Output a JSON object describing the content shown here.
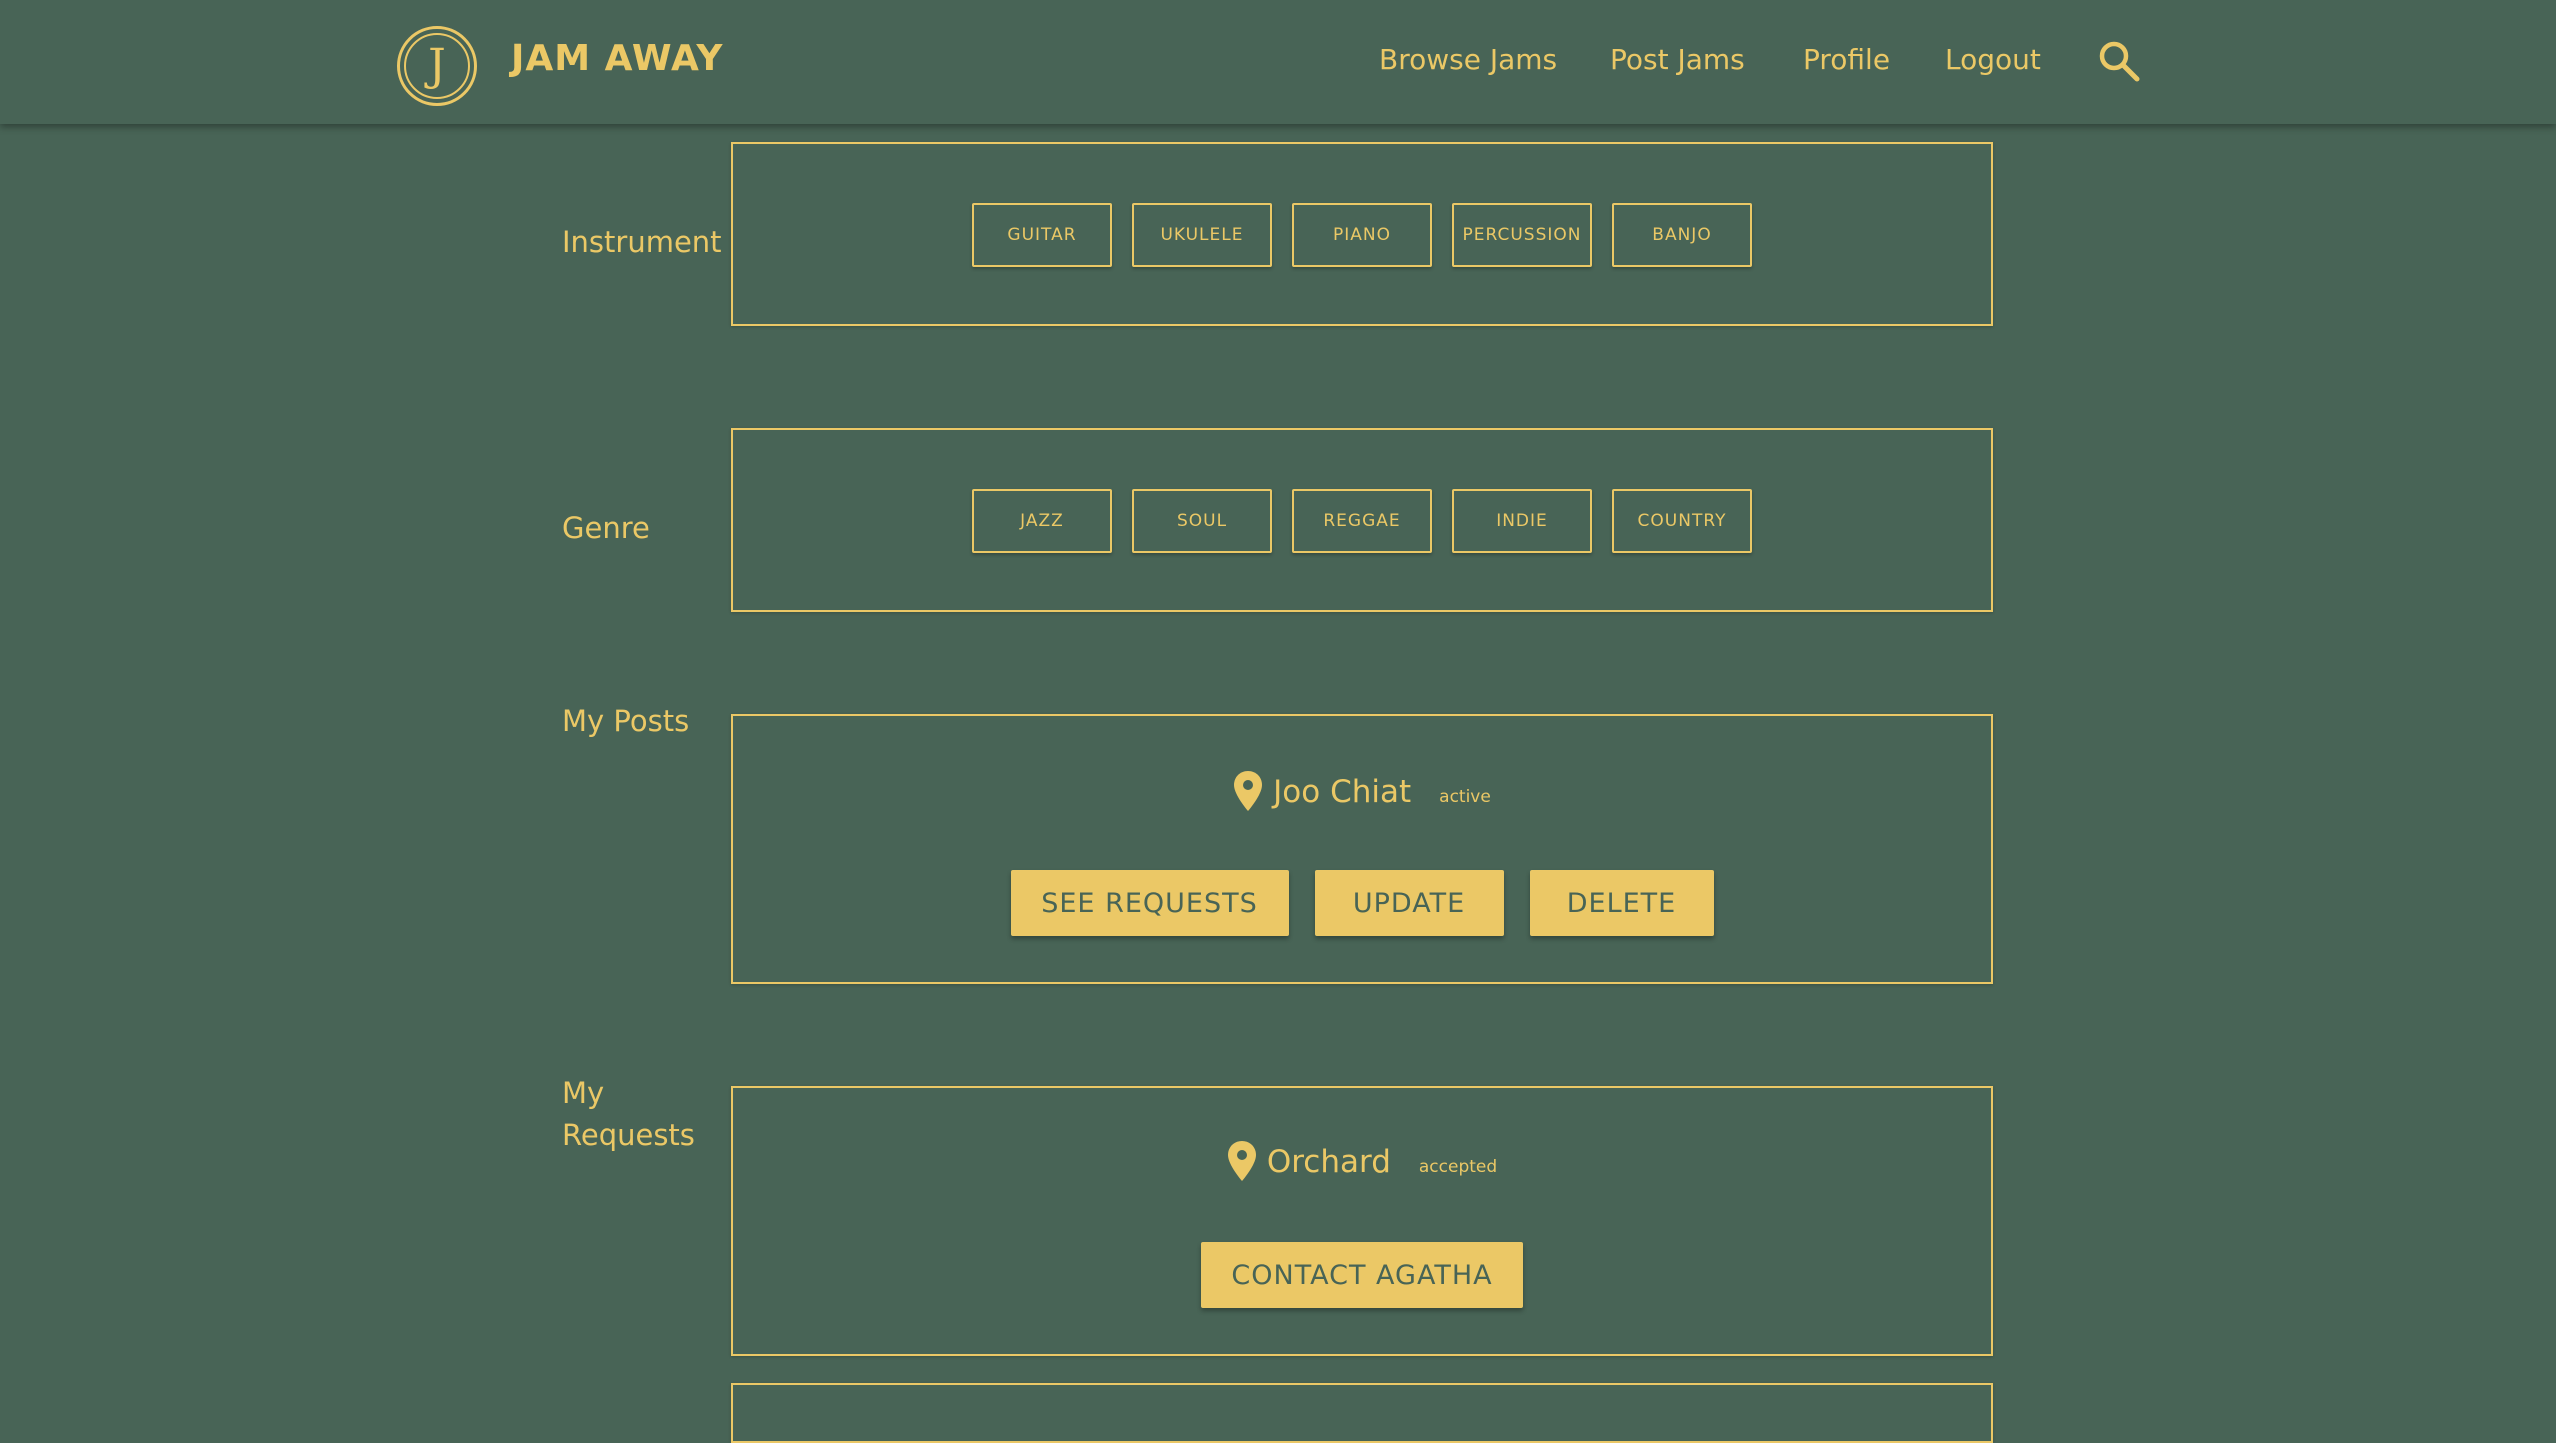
{
  "nav": {
    "logo_letter": "J",
    "brand": "JAM AWAY",
    "links": [
      "Browse Jams",
      "Post Jams",
      "Profile",
      "Logout"
    ]
  },
  "instrument": {
    "label": "Instrument",
    "options": [
      "GUITAR",
      "UKULELE",
      "PIANO",
      "PERCUSSION",
      "BANJO"
    ]
  },
  "genre": {
    "label": "Genre",
    "options": [
      "JAZZ",
      "SOUL",
      "REGGAE",
      "INDIE",
      "COUNTRY"
    ]
  },
  "my_posts": {
    "label": "My Posts",
    "location": "Joo Chiat",
    "status": "active",
    "buttons": [
      "SEE REQUESTS",
      "UPDATE",
      "DELETE"
    ]
  },
  "my_requests": {
    "label_line1": "My",
    "label_line2": "Requests",
    "location": "Orchard",
    "status": "accepted",
    "button": "CONTACT AGATHA"
  },
  "colors": {
    "background": "#486456",
    "accent": "#ebc866"
  },
  "icons": {
    "search": "search-icon",
    "location": "location-pin-icon"
  }
}
